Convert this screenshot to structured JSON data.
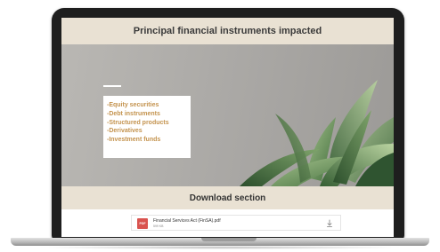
{
  "page": {
    "title": "Principal financial instruments impacted",
    "instruments": [
      "-Equity securities",
      "-Debt instruments",
      "-Structured products",
      "-Derivatives",
      "-Investment funds"
    ]
  },
  "download": {
    "title": "Download section",
    "file": {
      "icon_label": "PDF",
      "name": "Financial Services Act (FinSA).pdf",
      "size": "599 KB"
    }
  },
  "colors": {
    "band": "#e9e1d3",
    "accent_text": "#c4934e",
    "hero_bg": "#a9a7a4",
    "pdf_icon": "#d9534f"
  },
  "icons": {
    "file": "pdf-file-icon",
    "download": "download-icon"
  }
}
